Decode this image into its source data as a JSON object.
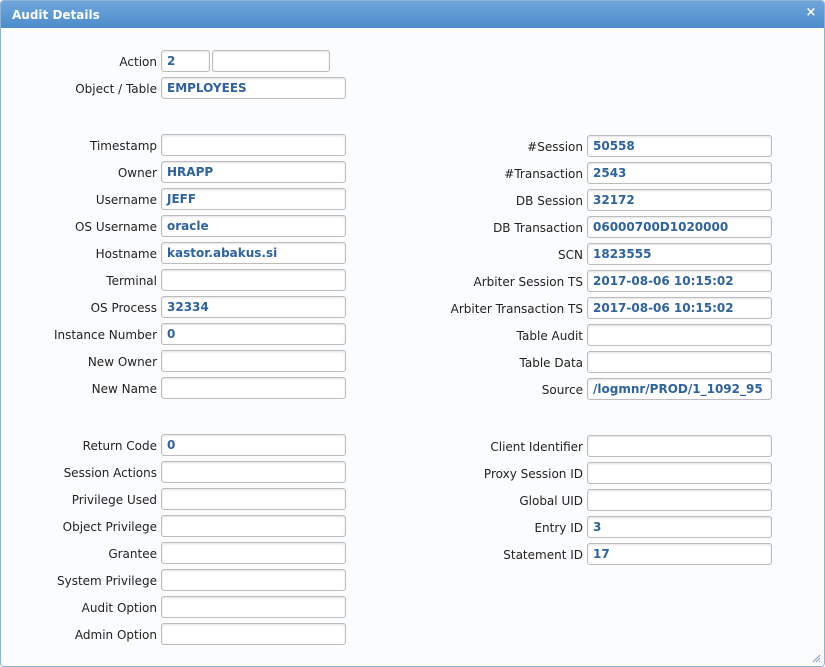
{
  "window": {
    "title": "Audit Details",
    "close_glyph": "×"
  },
  "left": {
    "action": {
      "label": "Action",
      "value": "2",
      "value2": ""
    },
    "object_table": {
      "label": "Object / Table",
      "value": "EMPLOYEES"
    },
    "timestamp": {
      "label": "Timestamp",
      "value": ""
    },
    "owner": {
      "label": "Owner",
      "value": "HRAPP"
    },
    "username": {
      "label": "Username",
      "value": "JEFF"
    },
    "os_username": {
      "label": "OS Username",
      "value": "oracle"
    },
    "hostname": {
      "label": "Hostname",
      "value": "kastor.abakus.si"
    },
    "terminal": {
      "label": "Terminal",
      "value": ""
    },
    "os_process": {
      "label": "OS Process",
      "value": "32334"
    },
    "instance_number": {
      "label": "Instance Number",
      "value": "0"
    },
    "new_owner": {
      "label": "New Owner",
      "value": ""
    },
    "new_name": {
      "label": "New Name",
      "value": ""
    },
    "return_code": {
      "label": "Return Code",
      "value": "0"
    },
    "session_actions": {
      "label": "Session Actions",
      "value": ""
    },
    "privilege_used": {
      "label": "Privilege Used",
      "value": ""
    },
    "object_privilege": {
      "label": "Object Privilege",
      "value": ""
    },
    "grantee": {
      "label": "Grantee",
      "value": ""
    },
    "system_privilege": {
      "label": "System Privilege",
      "value": ""
    },
    "audit_option": {
      "label": "Audit Option",
      "value": ""
    },
    "admin_option": {
      "label": "Admin Option",
      "value": ""
    }
  },
  "right": {
    "session": {
      "label": "#Session",
      "value": "50558"
    },
    "transaction": {
      "label": "#Transaction",
      "value": "2543"
    },
    "db_session": {
      "label": "DB Session",
      "value": "32172"
    },
    "db_transaction": {
      "label": "DB Transaction",
      "value": "06000700D1020000"
    },
    "scn": {
      "label": "SCN",
      "value": "1823555"
    },
    "arbiter_session_ts": {
      "label": "Arbiter Session TS",
      "value": "2017-08-06 10:15:02"
    },
    "arbiter_transaction_ts": {
      "label": "Arbiter Transaction TS",
      "value": "2017-08-06 10:15:02"
    },
    "table_audit": {
      "label": "Table Audit",
      "value": ""
    },
    "table_data": {
      "label": "Table Data",
      "value": ""
    },
    "source": {
      "label": "Source",
      "value": "/logmnr/PROD/1_1092_95"
    },
    "client_identifier": {
      "label": "Client Identifier",
      "value": ""
    },
    "proxy_session_id": {
      "label": "Proxy Session ID",
      "value": ""
    },
    "global_uid": {
      "label": "Global UID",
      "value": ""
    },
    "entry_id": {
      "label": "Entry ID",
      "value": "3"
    },
    "statement_id": {
      "label": "Statement ID",
      "value": "17"
    }
  },
  "colors": {
    "titlebar": "#5b97d2",
    "value_text": "#2e62a0"
  }
}
